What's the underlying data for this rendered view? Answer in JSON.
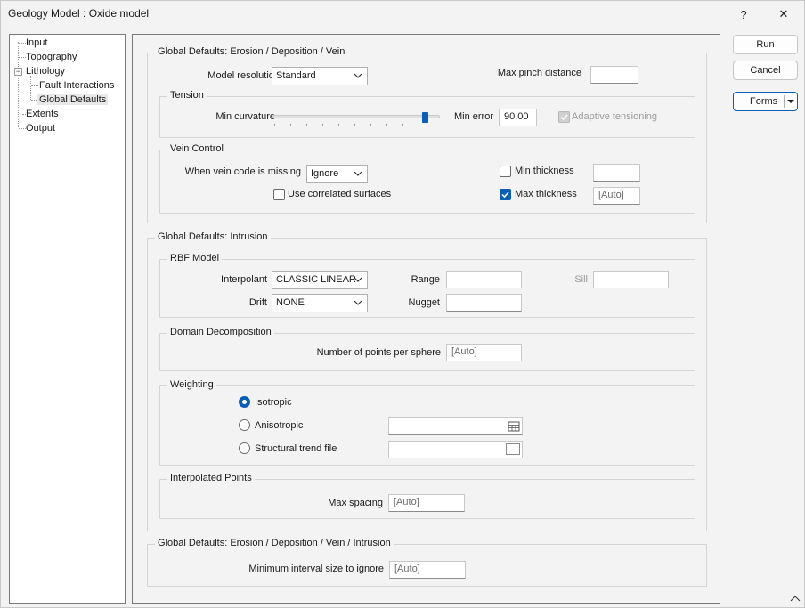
{
  "window": {
    "title": "Geology Model : Oxide model",
    "help_label": "?",
    "close_label": "✕"
  },
  "tree": {
    "items": [
      {
        "label": "Input"
      },
      {
        "label": "Topography"
      },
      {
        "label": "Lithology"
      },
      {
        "label": "Fault Interactions"
      },
      {
        "label": "Global Defaults"
      },
      {
        "label": "Extents"
      },
      {
        "label": "Output"
      }
    ],
    "selected": "Global Defaults"
  },
  "buttons": {
    "run": "Run",
    "cancel": "Cancel",
    "forms": "Forms"
  },
  "erosion": {
    "title": "Global Defaults: Erosion / Deposition / Vein",
    "model_resolution_label": "Model resolution",
    "model_resolution_value": "Standard",
    "max_pinch_label": "Max pinch distance",
    "max_pinch_value": "",
    "tension": {
      "title": "Tension",
      "min_curvature_label": "Min curvature",
      "min_curvature_level": 0.93,
      "min_error_label": "Min error",
      "min_error_value": "90.00",
      "adaptive_label": "Adaptive tensioning",
      "adaptive_checked": true,
      "adaptive_disabled": true
    },
    "vein": {
      "title": "Vein Control",
      "missing_label": "When vein code is missing",
      "missing_value": "Ignore",
      "correlated_label": "Use correlated surfaces",
      "correlated_checked": false,
      "min_thickness_label": "Min thickness",
      "min_thickness_checked": false,
      "min_thickness_value": "",
      "max_thickness_label": "Max thickness",
      "max_thickness_checked": true,
      "max_thickness_value": "[Auto]"
    }
  },
  "intrusion": {
    "title": "Global Defaults: Intrusion",
    "rbf": {
      "title": "RBF Model",
      "interpolant_label": "Interpolant",
      "interpolant_value": "CLASSIC LINEAR",
      "drift_label": "Drift",
      "drift_value": "NONE",
      "range_label": "Range",
      "range_value": "",
      "nugget_label": "Nugget",
      "nugget_value": "",
      "sill_label": "Sill",
      "sill_value": ""
    },
    "domain": {
      "title": "Domain Decomposition",
      "points_label": "Number of points per sphere",
      "points_value": "[Auto]"
    },
    "weighting": {
      "title": "Weighting",
      "options": [
        "Isotropic",
        "Anisotropic",
        "Structural trend file"
      ],
      "selected": "Isotropic",
      "anisotropic_value": "",
      "trend_file_value": "",
      "browse_label": "..."
    },
    "interp_points": {
      "title": "Interpolated Points",
      "max_spacing_label": "Max spacing",
      "max_spacing_value": "[Auto]"
    }
  },
  "combined": {
    "title": "Global Defaults: Erosion / Deposition / Vein / Intrusion",
    "min_interval_label": "Minimum interval size to ignore",
    "min_interval_value": "[Auto]"
  },
  "colors": {
    "accent": "#0a5fb4",
    "border": "#7a7a7a",
    "background": "#f3f3f3"
  }
}
